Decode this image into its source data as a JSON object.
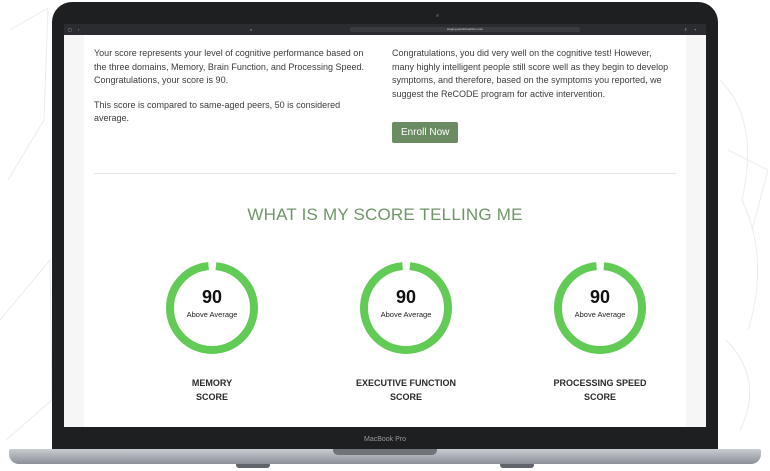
{
  "device": {
    "model_label": "MacBook Pro"
  },
  "browser": {
    "address": "staging.apollohealthco.com"
  },
  "left_column": {
    "para1": "Your score represents your level of cognitive performance based on the three domains, Memory, Brain Function, and Processing Speed. Congratulations, your score is 90.",
    "para2": "This score is compared to same-aged peers, 50 is considered average."
  },
  "right_column": {
    "para1": "Congratulations, you did very well on the cognitive test! However, many highly intelligent people still score well as they begin to develop symptoms, and therefore, based on the symptoms you reported, we suggest the ReCODE program for active intervention.",
    "enroll_label": "Enroll Now"
  },
  "section_title": "WHAT IS MY SCORE TELLING ME",
  "colors": {
    "accent": "#6b8b63",
    "gauge": "#62cb55",
    "title": "#6f9567"
  },
  "scores": [
    {
      "value": "90",
      "rating": "Above Average",
      "label_line1": "MEMORY",
      "label_line2": "SCORE",
      "fill_fraction": 0.97
    },
    {
      "value": "90",
      "rating": "Above Average",
      "label_line1": "EXECUTIVE FUNCTION",
      "label_line2": "SCORE",
      "fill_fraction": 0.97
    },
    {
      "value": "90",
      "rating": "Above Average",
      "label_line1": "PROCESSING SPEED",
      "label_line2": "SCORE",
      "fill_fraction": 0.97
    }
  ]
}
